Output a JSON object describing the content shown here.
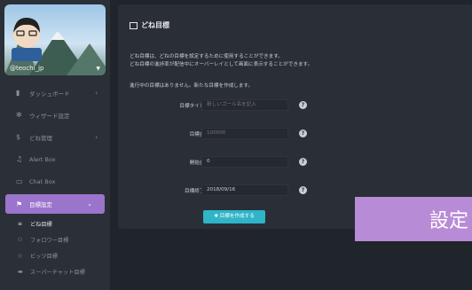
{
  "user": {
    "name": "@teochi_jp"
  },
  "sidebar": {
    "items": [
      {
        "label": "ダッシュボード",
        "icon": "bar-chart-icon",
        "chevron": "‹"
      },
      {
        "label": "ウィザード設定",
        "icon": "gear-icon"
      },
      {
        "label": "どね管理",
        "icon": "dollar-icon",
        "chevron": "‹"
      },
      {
        "label": "Alert Box",
        "icon": "bell-icon"
      },
      {
        "label": "Chat Box",
        "icon": "chat-icon"
      }
    ],
    "active": {
      "label": "目標設定",
      "icon": "flag-icon",
      "chevron": "⌄"
    },
    "subitems": [
      {
        "label": "どね目標",
        "icon": "bars-icon"
      },
      {
        "label": "フォロワー目標",
        "icon": "users-icon"
      },
      {
        "label": "ビッツ目標",
        "icon": "bits-icon"
      },
      {
        "label": "スーパーチャット目標",
        "icon": "card-icon"
      }
    ]
  },
  "page": {
    "title": "どね目標",
    "desc1": "どね目標は、どねの目標を設定するために使用することができます。",
    "desc2": "どね目標の進捗率が配信中にオーバーレイとして画面に表示することができます。",
    "no_active": "進行中の目標はありません。新たな目標を作成します。"
  },
  "form": {
    "title_label": "目標タイトル",
    "title_placeholder": "新しいゴール名を記入",
    "amount_label": "目標金額",
    "amount_placeholder": "100000",
    "start_label": "開始金額",
    "start_value": "0",
    "end_label": "目標終了日",
    "end_value": "2018/09/16",
    "help_glyph": "?",
    "create_button": "✚ 目標を作成する"
  },
  "overlay": {
    "text": "設定"
  },
  "colors": {
    "accent": "#9b74cc",
    "button": "#2fb4c8",
    "overlay": "#b88bd6"
  }
}
